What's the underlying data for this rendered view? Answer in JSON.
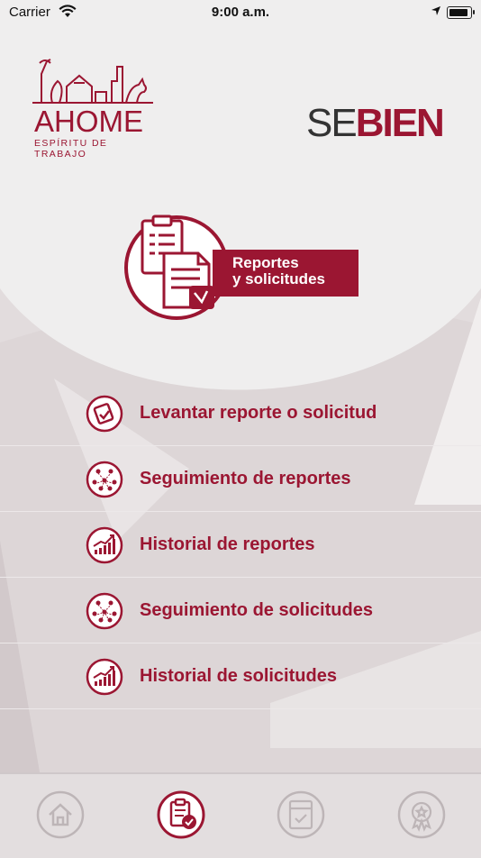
{
  "status_bar": {
    "carrier": "Carrier",
    "time": "9:00 a.m."
  },
  "header": {
    "ahome_logo": {
      "name": "AHOME",
      "tagline": "ESPÍRITU DE TRABAJO"
    },
    "sebien_logo": {
      "part1": "SE",
      "part2": "BIEN"
    }
  },
  "hero": {
    "label_line1": "Reportes",
    "label_line2": "y solicitudes"
  },
  "menu": [
    {
      "label": "Levantar reporte o solicitud",
      "icon": "report-paper-icon"
    },
    {
      "label": "Seguimiento de reportes",
      "icon": "people-network-icon"
    },
    {
      "label": "Historial de reportes",
      "icon": "growth-chart-icon"
    },
    {
      "label": "Seguimiento de solicitudes",
      "icon": "people-network-icon"
    },
    {
      "label": "Historial de solicitudes",
      "icon": "growth-chart-icon"
    }
  ],
  "tabbar": {
    "tabs": [
      {
        "icon": "home-icon",
        "active": false
      },
      {
        "icon": "clipboard-check-icon",
        "active": true
      },
      {
        "icon": "payment-receipt-icon",
        "active": false
      },
      {
        "icon": "award-badge-icon",
        "active": false
      }
    ]
  },
  "colors": {
    "primary": "#9b1632",
    "background": "#eeeded",
    "inactive": "#bdb5b7"
  }
}
